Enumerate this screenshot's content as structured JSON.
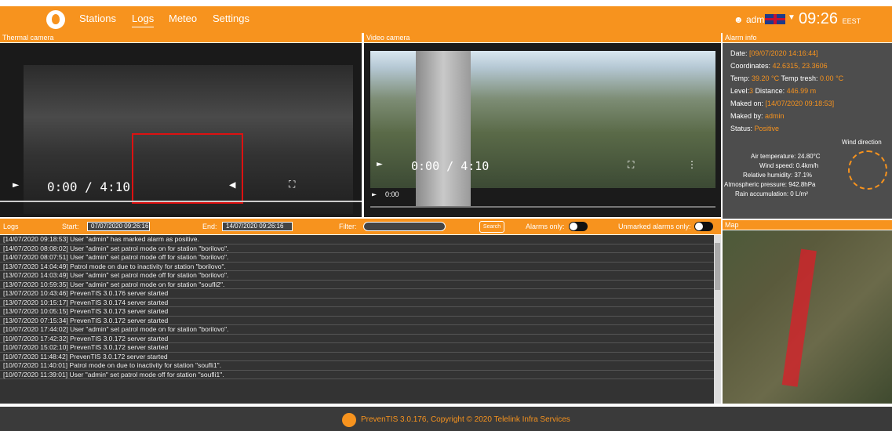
{
  "nav": {
    "items": [
      "Stations",
      "Logs",
      "Meteo",
      "Settings"
    ],
    "user": "admin",
    "clock": "09:26",
    "tz": "EEST"
  },
  "panels": {
    "thermal_title": "Thermal camera",
    "video_title": "Video camera",
    "alarm_title": "Alarm info",
    "map_title": "Map"
  },
  "thermal": {
    "time": "0:00 / 4:10"
  },
  "video": {
    "time": "0:00 / 4:10",
    "seek": "0:00"
  },
  "alarm": {
    "date_label": "Date:",
    "date_value": "[09/07/2020 14:16:44]",
    "coords_label": "Coordinates:",
    "coords_value": "42.6315, 23.3606",
    "temp_label": "Temp:",
    "temp_value": "39.20 °C",
    "tresh_label": "Temp tresh:",
    "tresh_value": "0.00 °C",
    "level_label": "Level:",
    "level_value": "3",
    "dist_label": "Distance:",
    "dist_value": "446.99 m",
    "maked_label": "Maked on:",
    "maked_value": "[14/07/2020 09:18:53]",
    "by_label": "Maked by:",
    "by_value": "admin",
    "status_label": "Status:",
    "status_value": "Positive",
    "wind_title": "Wind direction",
    "air": "Air temperature: 24.80°C",
    "wind": "Wind speed: 0.4km/h",
    "hum": "Relative humidity: 37.1%",
    "press": "Atmospheric pressure: 942.8hPa",
    "rain": "Rain accumulation: 0 L/m²"
  },
  "logs": {
    "title": "Logs",
    "start_label": "Start:",
    "start_value": "07/07/2020 09:26:16",
    "end_label": "End:",
    "end_value": "14/07/2020 09:26:16",
    "filter_label": "Filter:",
    "search": "Search",
    "alarms_only": "Alarms only:",
    "unmarked": "Unmarked alarms only:",
    "rows": [
      "[14/07/2020 09:18:53] User \"admin\" has marked alarm as positive.",
      "[14/07/2020 08:08:02] User \"admin\" set patrol mode on for station \"borilovo\".",
      "[14/07/2020 08:07:51] User \"admin\" set patrol mode off for station \"borilovo\".",
      "[13/07/2020 14:04:49] Patrol mode on due to inactivity for station \"borilovo\".",
      "[13/07/2020 14:03:49] User \"admin\" set patrol mode off for station \"borilovo\".",
      "[13/07/2020 10:59:35] User \"admin\" set patrol mode on for station \"soufli2\".",
      "[13/07/2020 10:43:46] PrevenTIS 3.0.176 server started",
      "[13/07/2020 10:15:17] PrevenTIS 3.0.174 server started",
      "[13/07/2020 10:05:15] PrevenTIS 3.0.173 server started",
      "[13/07/2020 07:15:34] PrevenTIS 3.0.172 server started",
      "[10/07/2020 17:44:02] User \"admin\" set patrol mode on for station \"borilovo\".",
      "[10/07/2020 17:42:32] PrevenTIS 3.0.172 server started",
      "[10/07/2020 15:02:10] PrevenTIS 3.0.172 server started",
      "[10/07/2020 11:48:42] PrevenTIS 3.0.172 server started",
      "[10/07/2020 11:40:01] Patrol mode on due to inactivity for station \"soufli1\".",
      "[10/07/2020 11:39:01] User \"admin\" set patrol mode off for station \"soufli1\"."
    ]
  },
  "footer": "PrevenTIS 3.0.176, Copyright © 2020 Telelink Infra Services"
}
